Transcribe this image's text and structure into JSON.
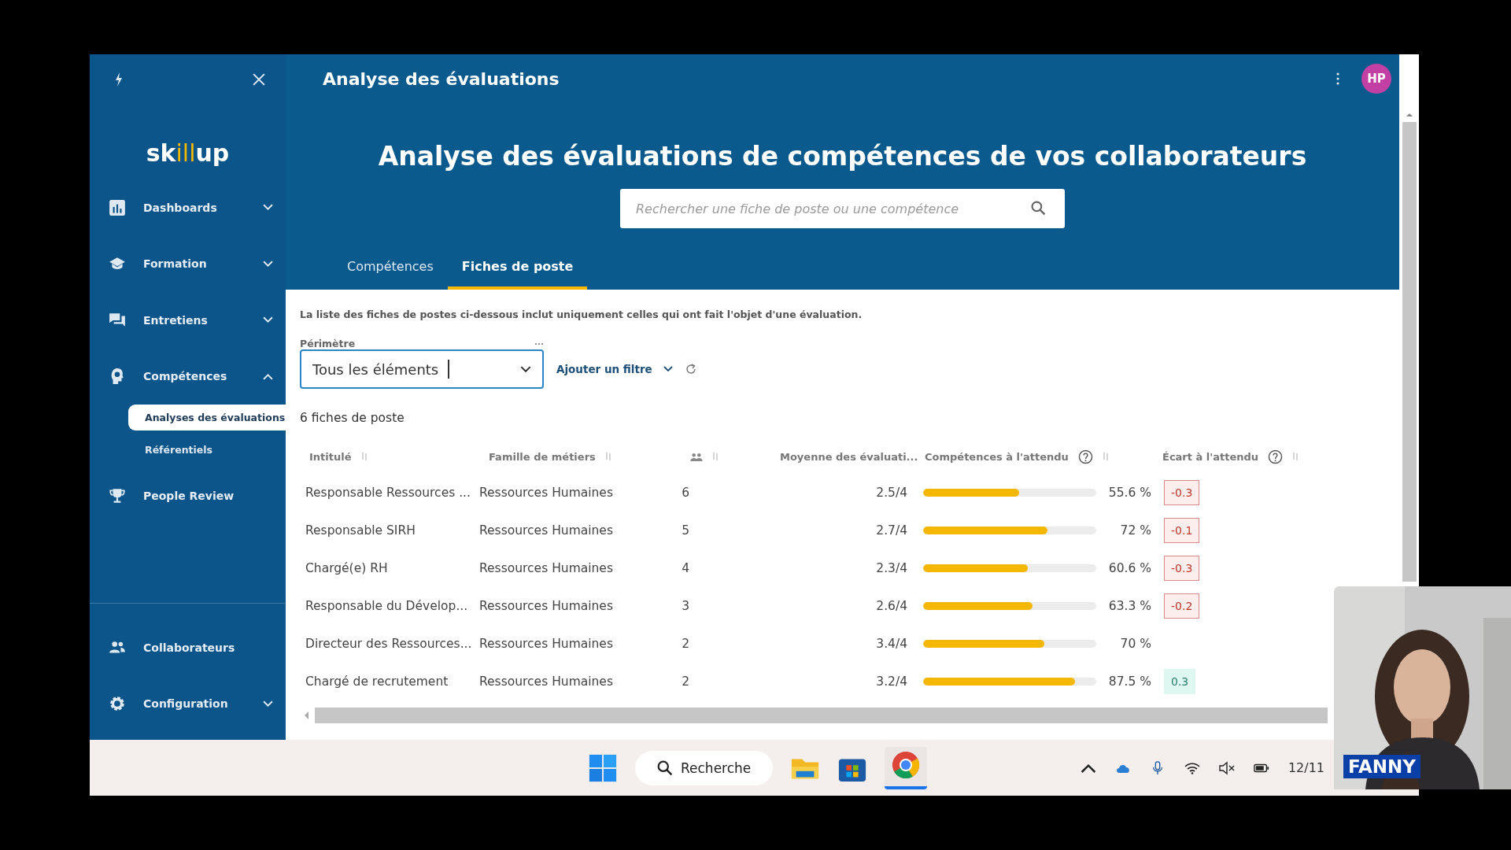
{
  "app_bar": {
    "title": "Analyse des évaluations",
    "avatar": "HP"
  },
  "sidebar": {
    "logo": {
      "start": "sk",
      "mark": "ill",
      "end": "up"
    },
    "items": [
      {
        "label": "Dashboards",
        "expanded": false
      },
      {
        "label": "Formation",
        "expanded": false
      },
      {
        "label": "Entretiens",
        "expanded": false
      },
      {
        "label": "Compétences",
        "expanded": true,
        "children": [
          {
            "label": "Analyses des évaluations",
            "selected": true
          },
          {
            "label": "Référentiels",
            "selected": false
          }
        ]
      },
      {
        "label": "People Review"
      }
    ],
    "bottom_items": [
      {
        "label": "Collaborateurs"
      },
      {
        "label": "Configuration",
        "expanded": false
      }
    ]
  },
  "hero": {
    "title": "Analyse des évaluations de compétences de vos collaborateurs",
    "search": {
      "placeholder": "Rechercher une fiche de poste ou une compétence"
    }
  },
  "tabs": [
    {
      "label": "Compétences",
      "selected": false
    },
    {
      "label": "Fiches de poste",
      "selected": true
    }
  ],
  "note": "La liste des fiches de postes ci-dessous inclut uniquement celles qui ont fait l'objet d'une évaluation.",
  "filter": {
    "label": "Périmètre",
    "value": "Tous les éléments",
    "add_filter": "Ajouter un filtre"
  },
  "count": "6 fiches de poste",
  "table": {
    "columns": [
      {
        "kind": "text",
        "label": "Intitulé"
      },
      {
        "kind": "text",
        "label": "Famille de métiers"
      },
      {
        "kind": "icon"
      },
      {
        "kind": "text",
        "label": "Moyenne des évaluati..."
      },
      {
        "kind": "help",
        "label": "Compétences à l'attendu"
      },
      {
        "kind": "help",
        "label": "Écart à l'attendu"
      }
    ],
    "rows": [
      {
        "title": "Responsable Ressources ...",
        "family": "Ressources Humaines",
        "count": "6",
        "average": "2.5/4",
        "level": 0.556,
        "percent": "55.6 %",
        "gap": "-0.3"
      },
      {
        "title": "Responsable SIRH",
        "family": "Ressources Humaines",
        "count": "5",
        "average": "2.7/4",
        "level": 0.72,
        "percent": "72 %",
        "gap": "-0.1"
      },
      {
        "title": "Chargé(e) RH",
        "family": "Ressources Humaines",
        "count": "4",
        "average": "2.3/4",
        "level": 0.606,
        "percent": "60.6 %",
        "gap": "-0.3"
      },
      {
        "title": "Responsable du Dévelop...",
        "family": "Ressources Humaines",
        "count": "3",
        "average": "2.6/4",
        "level": 0.633,
        "percent": "63.3 %",
        "gap": "-0.2"
      },
      {
        "title": "Directeur des Ressources...",
        "family": "Ressources Humaines",
        "count": "2",
        "average": "3.4/4",
        "level": 0.7,
        "percent": "70 %"
      },
      {
        "title": "Chargé de recrutement",
        "family": "Ressources Humaines",
        "count": "2",
        "average": "3.2/4",
        "level": 0.875,
        "percent": "87.5 %",
        "gap": "0.3"
      }
    ]
  },
  "taskbar": {
    "search": "Recherche",
    "date": "12/11"
  },
  "webcam": {
    "kind": "picture",
    "name": "FANNY"
  }
}
